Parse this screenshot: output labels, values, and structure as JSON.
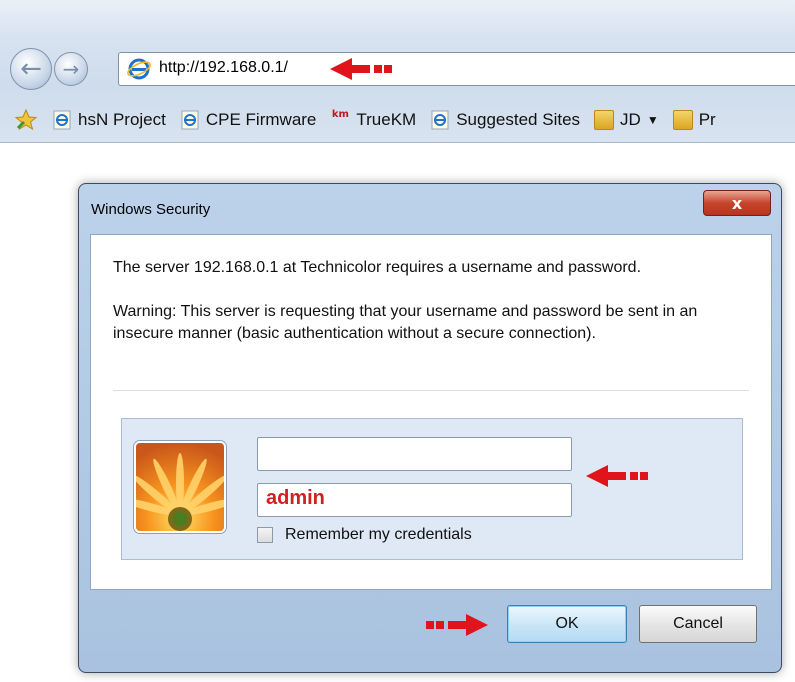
{
  "browser": {
    "url": "http://192.168.0.1/",
    "favorites": [
      {
        "label": "hsN Project",
        "icon": "ie-page-icon"
      },
      {
        "label": "CPE Firmware",
        "icon": "ie-page-icon"
      },
      {
        "label": "TrueKM",
        "icon": "km-icon",
        "icon_text": "km"
      },
      {
        "label": "Suggested Sites",
        "icon": "ie-page-icon"
      },
      {
        "label": "JD",
        "icon": "folder-icon",
        "has_dropdown": true
      },
      {
        "label": "Pr",
        "icon": "folder-icon"
      }
    ]
  },
  "dialog": {
    "title": "Windows Security",
    "close_symbol": "x",
    "message": "The server 192.168.0.1 at Technicolor requires a username and password.",
    "warning": "Warning: This server is requesting that your username and password be sent in an insecure manner (basic authentication without a secure connection).",
    "username_value": "",
    "password_value": "admin",
    "remember_label": "Remember my credentials",
    "remember_checked": false,
    "ok_label": "OK",
    "cancel_label": "Cancel"
  },
  "colors": {
    "annotation_arrow": "#e0151b",
    "password_text": "#d21f1f"
  }
}
